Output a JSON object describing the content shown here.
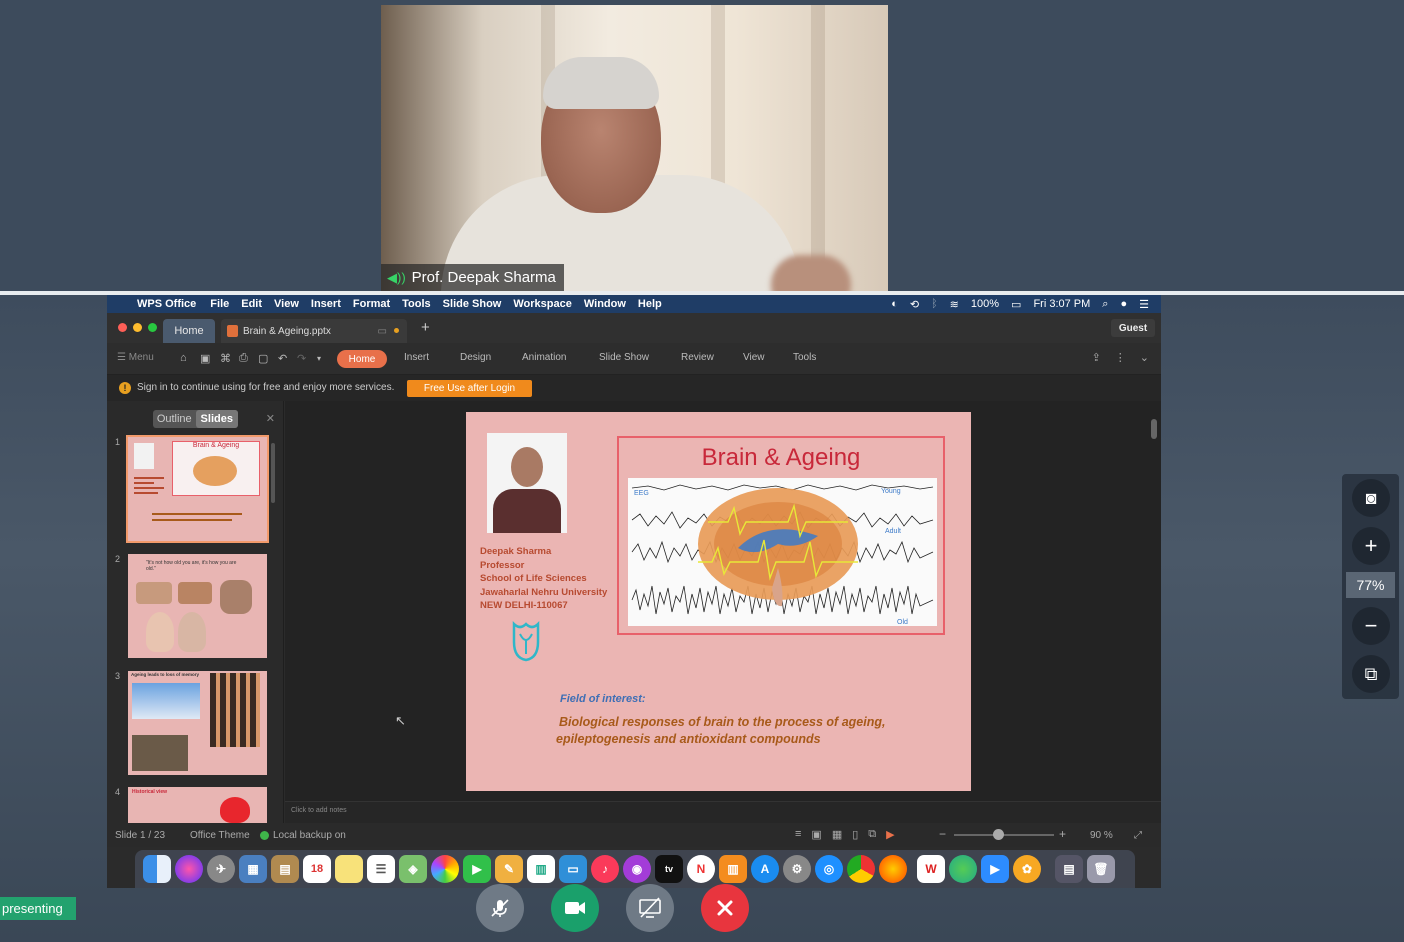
{
  "participant": {
    "name": "Prof. Deepak Sharma"
  },
  "mac_menubar": {
    "app": "WPS Office",
    "menus": [
      "File",
      "Edit",
      "View",
      "Insert",
      "Format",
      "Tools",
      "Slide Show",
      "Workspace",
      "Window",
      "Help"
    ],
    "battery": "100%",
    "clock": "Fri 3:07 PM"
  },
  "wps": {
    "tab_home": "Home",
    "doc_tab": "Brain & Ageing.pptx",
    "guest": "Guest",
    "menu_label": "Menu",
    "ribbon_tabs": [
      "Home",
      "Insert",
      "Design",
      "Animation",
      "Slide Show",
      "Review",
      "View",
      "Tools"
    ],
    "notice": "Sign in to continue using for free and enjoy more services.",
    "free_button": "Free Use after Login",
    "panel_tabs": {
      "outline": "Outline",
      "slides": "Slides"
    },
    "thumb_numbers": [
      "1",
      "2",
      "3",
      "4"
    ],
    "notes_placeholder": "Click to add notes",
    "status": {
      "slide": "Slide 1 / 23",
      "theme": "Office Theme",
      "backup": "Local backup on",
      "zoom": "90 %"
    }
  },
  "slide": {
    "title": "Brain & Ageing",
    "bio_lines": [
      "Deepak Sharma",
      "Professor",
      "School of Life Sciences",
      "Jawaharlal Nehru University",
      "NEW DELHI-110067"
    ],
    "eeg_labels": {
      "eeg": "EEG",
      "young": "Young",
      "adult": "Adult",
      "old": "Old"
    },
    "field_label": "Field of interest:",
    "field_lines": [
      "Biological responses of brain to the process of ageing,",
      "epileptogenesis and antioxidant compounds"
    ]
  },
  "thumbs": {
    "t1_title": "Brain & Ageing",
    "t2_quote": "\"It's not how old you are, it's how you are old.\"",
    "t3_title": "Ageing leads to loss of memory",
    "t4_title": "Historical view"
  },
  "side_zoom": "77%",
  "presenting": "presenting",
  "colors": {
    "accent_orange": "#e8704a",
    "end_call": "#e8353e",
    "video_on": "#1aa06b",
    "presenting": "#23a26e"
  }
}
